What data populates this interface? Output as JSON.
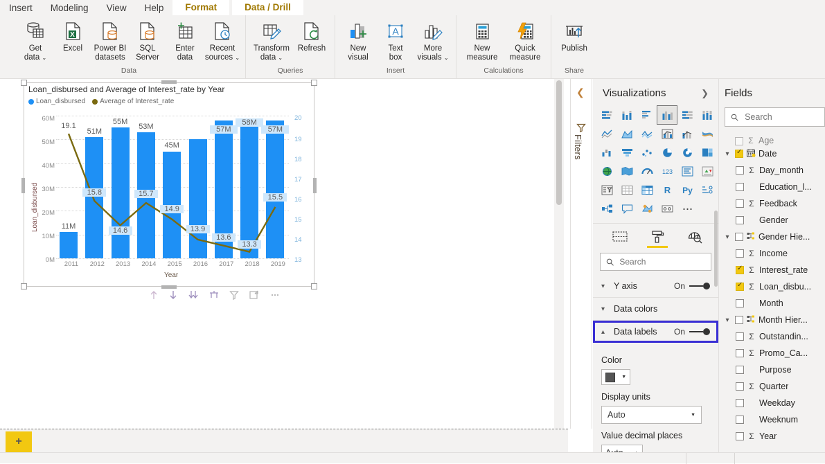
{
  "ribbon": {
    "tabs": [
      {
        "label": "Insert",
        "ctx": false
      },
      {
        "label": "Modeling",
        "ctx": false
      },
      {
        "label": "View",
        "ctx": false
      },
      {
        "label": "Help",
        "ctx": false
      },
      {
        "label": "Format",
        "ctx": true
      },
      {
        "label": "Data / Drill",
        "ctx": true
      }
    ],
    "groups": [
      {
        "title": "Data",
        "buttons": [
          {
            "label": "Get data",
            "icon": "get-data-icon",
            "caret": true
          },
          {
            "label": "Excel",
            "icon": "excel-icon",
            "caret": false
          },
          {
            "label": "Power BI datasets",
            "icon": "powerbi-datasets-icon",
            "caret": false
          },
          {
            "label": "SQL Server",
            "icon": "sql-server-icon",
            "caret": false
          },
          {
            "label": "Enter data",
            "icon": "enter-data-icon",
            "caret": false
          },
          {
            "label": "Recent sources",
            "icon": "recent-sources-icon",
            "caret": true
          }
        ]
      },
      {
        "title": "Queries",
        "buttons": [
          {
            "label": "Transform data",
            "icon": "transform-data-icon",
            "caret": true
          },
          {
            "label": "Refresh",
            "icon": "refresh-icon",
            "caret": false
          }
        ]
      },
      {
        "title": "Insert",
        "buttons": [
          {
            "label": "New visual",
            "icon": "new-visual-icon",
            "caret": false
          },
          {
            "label": "Text box",
            "icon": "text-box-icon",
            "caret": false
          },
          {
            "label": "More visuals",
            "icon": "more-visuals-icon",
            "caret": true
          }
        ]
      },
      {
        "title": "Calculations",
        "buttons": [
          {
            "label": "New measure",
            "icon": "new-measure-icon",
            "caret": false
          },
          {
            "label": "Quick measure",
            "icon": "quick-measure-icon",
            "caret": false
          }
        ]
      },
      {
        "title": "Share",
        "buttons": [
          {
            "label": "Publish",
            "icon": "publish-icon",
            "caret": false
          }
        ]
      }
    ]
  },
  "visual": {
    "title": "Loan_disbursed and Average of Interest_rate by Year",
    "toolbar_icons": [
      "drill-up-icon",
      "drill-down-icon",
      "expand-all-icon",
      "drill-mode-icon",
      "filter-icon",
      "focus-mode-icon",
      "more-options-icon"
    ]
  },
  "chart_data": {
    "type": "bar",
    "title": "Loan_disbursed and Average of Interest_rate by Year",
    "xlabel": "Year",
    "ylabel": "Loan_disbursed",
    "categories": [
      "2011",
      "2012",
      "2013",
      "2014",
      "2015",
      "2016",
      "2017",
      "2018",
      "2019"
    ],
    "y_ticks": [
      "0M",
      "10M",
      "20M",
      "30M",
      "40M",
      "50M",
      "60M"
    ],
    "ylim": [
      0,
      60
    ],
    "y2_ticks": [
      "13",
      "14",
      "15",
      "16",
      "17",
      "18",
      "19",
      "20"
    ],
    "y2lim": [
      13,
      20
    ],
    "grid": true,
    "legend_position": "top-left",
    "series": [
      {
        "name": "Loan_disbursed",
        "type": "bar",
        "color": "#1e90f5",
        "axis": "left",
        "values": [
          11,
          51,
          55,
          53,
          45,
          50,
          57,
          58,
          57
        ],
        "labels": [
          "11M",
          "51M",
          "55M",
          "53M",
          "45M",
          "",
          "57M",
          "58M",
          "57M"
        ]
      },
      {
        "name": "Average of Interest_rate",
        "type": "line",
        "color": "#7a6a10",
        "axis": "right",
        "values": [
          19.1,
          15.8,
          14.6,
          15.7,
          14.9,
          13.9,
          13.6,
          13.3,
          15.5
        ],
        "labels": [
          "19.1",
          "15.8",
          "14.6",
          "15.7",
          "14.9",
          "13.9",
          "13.6",
          "13.3",
          "15.5"
        ]
      }
    ]
  },
  "filters_pane": {
    "title": "Filters",
    "collapse_icon": "chevron-left-icon",
    "filter_icon": "filter-icon"
  },
  "visualizations": {
    "title": "Visualizations",
    "expand_icon": "chevron-right-icon",
    "icons": [
      "stacked-bar-chart-icon",
      "stacked-column-chart-icon",
      "clustered-bar-chart-icon",
      "clustered-column-chart-icon",
      "100-stacked-bar-chart-icon",
      "100-stacked-column-chart-icon",
      "line-chart-icon",
      "area-chart-icon",
      "stacked-area-chart-icon",
      "line-and-stacked-column-chart-icon",
      "line-and-clustered-column-chart-icon",
      "ribbon-chart-icon",
      "waterfall-chart-icon",
      "funnel-chart-icon",
      "scatter-chart-icon",
      "pie-chart-icon",
      "donut-chart-icon",
      "treemap-icon",
      "map-icon",
      "filled-map-icon",
      "gauge-icon",
      "card-icon",
      "multi-row-card-icon",
      "kpi-icon",
      "slicer-icon",
      "table-icon",
      "matrix-icon",
      "r-script-visual-icon",
      "python-visual-icon",
      "key-influencers-icon",
      "decomposition-tree-icon",
      "q-and-a-icon",
      "arcgis-maps-icon",
      "paginated-report-icon",
      "more-visuals-ellipsis-icon"
    ],
    "selected_icon_index": 9,
    "pane_tabs": [
      {
        "name": "fields-tab",
        "icon": "fields-grid-icon",
        "active": false
      },
      {
        "name": "format-tab",
        "icon": "paint-roller-icon",
        "active": true
      },
      {
        "name": "analytics-tab",
        "icon": "analytics-magnifier-icon",
        "active": false
      }
    ],
    "search_placeholder": "Search",
    "sections": [
      {
        "label": "Y axis",
        "state": "On",
        "expanded": false,
        "highlighted": false,
        "has_toggle": true
      },
      {
        "label": "Data colors",
        "state": "",
        "expanded": false,
        "highlighted": false,
        "has_toggle": false
      },
      {
        "label": "Data labels",
        "state": "On",
        "expanded": true,
        "highlighted": true,
        "has_toggle": true
      }
    ],
    "data_labels": {
      "color_label": "Color",
      "color_value": "#555555",
      "display_units_label": "Display units",
      "display_units_value": "Auto",
      "value_decimal_label": "Value decimal places",
      "value_decimal_value": "Auto"
    },
    "highlight_color": "#3a2fd4"
  },
  "fields": {
    "title": "Fields",
    "search_placeholder": "Search",
    "items": [
      {
        "label": "Age",
        "checked": false,
        "sigma": true,
        "expand": false,
        "hierarchy": false,
        "partial": true
      },
      {
        "label": "Date",
        "checked": true,
        "sigma": false,
        "expand": true,
        "hierarchy": false,
        "calendar": true
      },
      {
        "label": "Day_month",
        "checked": false,
        "sigma": true,
        "expand": false,
        "hierarchy": false
      },
      {
        "label": "Education_l...",
        "checked": false,
        "sigma": false,
        "expand": false,
        "hierarchy": false
      },
      {
        "label": "Feedback",
        "checked": false,
        "sigma": true,
        "expand": false,
        "hierarchy": false
      },
      {
        "label": "Gender",
        "checked": false,
        "sigma": false,
        "expand": false,
        "hierarchy": false
      },
      {
        "label": "Gender Hie...",
        "checked": false,
        "sigma": false,
        "expand": true,
        "hierarchy": true
      },
      {
        "label": "Income",
        "checked": false,
        "sigma": true,
        "expand": false,
        "hierarchy": false
      },
      {
        "label": "Interest_rate",
        "checked": true,
        "sigma": true,
        "expand": false,
        "hierarchy": false
      },
      {
        "label": "Loan_disbu...",
        "checked": true,
        "sigma": true,
        "expand": false,
        "hierarchy": false
      },
      {
        "label": "Month",
        "checked": false,
        "sigma": false,
        "expand": false,
        "hierarchy": false
      },
      {
        "label": "Month Hier...",
        "checked": false,
        "sigma": false,
        "expand": true,
        "hierarchy": true
      },
      {
        "label": "Outstandin...",
        "checked": false,
        "sigma": true,
        "expand": false,
        "hierarchy": false
      },
      {
        "label": "Promo_Ca...",
        "checked": false,
        "sigma": true,
        "expand": false,
        "hierarchy": false
      },
      {
        "label": "Purpose",
        "checked": false,
        "sigma": false,
        "expand": false,
        "hierarchy": false
      },
      {
        "label": "Quarter",
        "checked": false,
        "sigma": true,
        "expand": false,
        "hierarchy": false
      },
      {
        "label": "Weekday",
        "checked": false,
        "sigma": false,
        "expand": false,
        "hierarchy": false
      },
      {
        "label": "Weeknum",
        "checked": false,
        "sigma": false,
        "expand": false,
        "hierarchy": false
      },
      {
        "label": "Year",
        "checked": false,
        "sigma": true,
        "expand": false,
        "hierarchy": false
      }
    ]
  },
  "page_strip": {
    "add_page_label": "+"
  },
  "status_bar": {
    "text": ""
  }
}
